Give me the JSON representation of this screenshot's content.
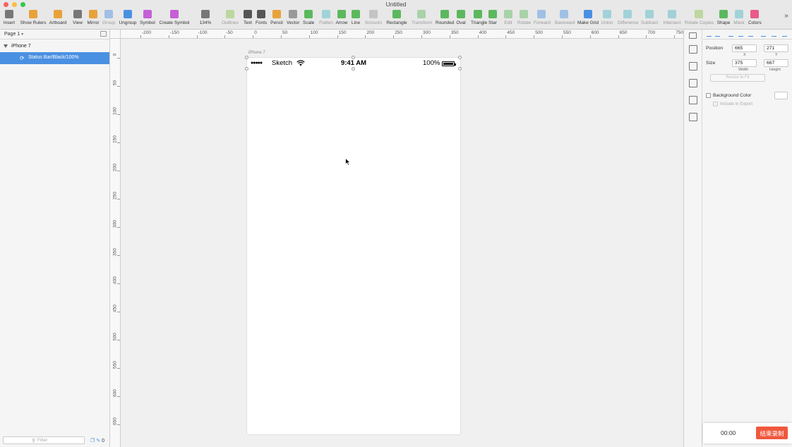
{
  "window": {
    "title": "Untitled"
  },
  "toolbar": {
    "items": [
      {
        "label": "Insert",
        "color": "#777777",
        "dim": false
      },
      {
        "label": "Show Rulers",
        "color": "#e8a23a",
        "dim": false
      },
      {
        "label": "Artboard",
        "color": "#e8a23a",
        "dim": false
      },
      {
        "label": "View",
        "color": "#777777",
        "dim": false
      },
      {
        "label": "Mirror",
        "color": "#e8a23a",
        "dim": false
      },
      {
        "label": "Group",
        "color": "#4a90e2",
        "dim": true
      },
      {
        "label": "Ungroup",
        "color": "#4a90e2",
        "dim": false
      },
      {
        "label": "Symbol",
        "color": "#c55fd6",
        "dim": false
      },
      {
        "label": "Create Symbol",
        "color": "#c55fd6",
        "dim": false
      },
      {
        "label": "134%",
        "color": "#777777",
        "dim": false
      },
      {
        "label": "Outlines",
        "color": "#8bc34a",
        "dim": true
      },
      {
        "label": "Text",
        "color": "#555555",
        "dim": false
      },
      {
        "label": "Fonts",
        "color": "#555555",
        "dim": false
      },
      {
        "label": "Pencil",
        "color": "#e8a23a",
        "dim": false
      },
      {
        "label": "Vector",
        "color": "#999999",
        "dim": false
      },
      {
        "label": "Scale",
        "color": "#5cb85c",
        "dim": false
      },
      {
        "label": "Flatten",
        "color": "#4ab8c5",
        "dim": true
      },
      {
        "label": "Arrow",
        "color": "#5cb85c",
        "dim": false
      },
      {
        "label": "Line",
        "color": "#5cb85c",
        "dim": false
      },
      {
        "label": "Scissors",
        "color": "#999999",
        "dim": true
      },
      {
        "label": "Rectangle",
        "color": "#5cb85c",
        "dim": false
      },
      {
        "label": "Transform",
        "color": "#5cb85c",
        "dim": true
      },
      {
        "label": "Rounded",
        "color": "#5cb85c",
        "dim": false
      },
      {
        "label": "Oval",
        "color": "#5cb85c",
        "dim": false
      },
      {
        "label": "Triangle",
        "color": "#5cb85c",
        "dim": false
      },
      {
        "label": "Star",
        "color": "#5cb85c",
        "dim": false
      },
      {
        "label": "Edit",
        "color": "#5cb85c",
        "dim": true
      },
      {
        "label": "Rotate",
        "color": "#5cb85c",
        "dim": true
      },
      {
        "label": "Forward",
        "color": "#4a90e2",
        "dim": true
      },
      {
        "label": "Backward",
        "color": "#4a90e2",
        "dim": true
      },
      {
        "label": "Make Grid",
        "color": "#4a90e2",
        "dim": false
      },
      {
        "label": "Union",
        "color": "#4ab8c5",
        "dim": true
      },
      {
        "label": "Difference",
        "color": "#4ab8c5",
        "dim": true
      },
      {
        "label": "Subtract",
        "color": "#4ab8c5",
        "dim": true
      },
      {
        "label": "Intersect",
        "color": "#4ab8c5",
        "dim": true
      },
      {
        "label": "Rotate Copies",
        "color": "#8bc34a",
        "dim": true
      },
      {
        "label": "Shape",
        "color": "#5cb85c",
        "dim": false
      },
      {
        "label": "Mask",
        "color": "#4ab8c5",
        "dim": true
      },
      {
        "label": "Colors",
        "color": "#e85a8a",
        "dim": false
      }
    ],
    "more_icon": "chevron-double-right-icon"
  },
  "layers": {
    "page_label": "Page 1",
    "artboard_name": "iPhone 7",
    "selected_layer": "Status Bar/Black/100%",
    "filter_placeholder": "Filter",
    "footer_count": "0"
  },
  "ruler": {
    "top_labels": [
      "-200",
      "-150",
      "-100",
      "-50",
      "0",
      "50",
      "100",
      "150",
      "200",
      "250",
      "300",
      "350",
      "400",
      "450",
      "500",
      "550",
      "600",
      "650",
      "700",
      "750"
    ],
    "left_labels": [
      "0",
      "50",
      "100",
      "150",
      "200",
      "250",
      "300",
      "350",
      "400",
      "450",
      "500",
      "550",
      "600",
      "650"
    ]
  },
  "artboard": {
    "title": "iPhone 7",
    "statusbar": {
      "carrier": "Sketch",
      "time": "9:41 AM",
      "battery": "100%"
    }
  },
  "inspector": {
    "position_label": "Position",
    "x_value": "665",
    "y_value": "271",
    "x_sub": "X",
    "y_sub": "Y",
    "size_label": "Size",
    "width_value": "375",
    "height_value": "667",
    "width_sub": "Width",
    "height_sub": "Height",
    "resize_label": "Resize to Fit",
    "bg_color_label": "Background Color",
    "include_export_label": "Include in Export",
    "bg_color_value": "#ffffff"
  },
  "recorder": {
    "time": "00:00",
    "stop_label": "结束录制"
  }
}
